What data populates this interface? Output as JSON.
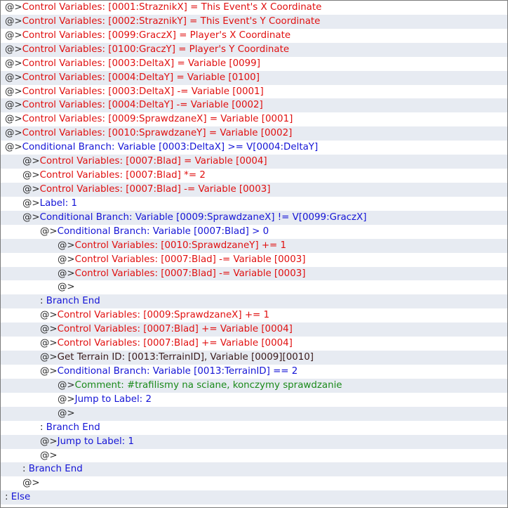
{
  "event_commands": [
    {
      "indent": 0,
      "prefix": "@>",
      "text": "Control Variables: [0001:StraznikX] = This Event's X Coordinate",
      "color": "red"
    },
    {
      "indent": 0,
      "prefix": "@>",
      "text": "Control Variables: [0002:StraznikY] = This Event's Y Coordinate",
      "color": "red"
    },
    {
      "indent": 0,
      "prefix": "@>",
      "text": "Control Variables: [0099:GraczX] = Player's X Coordinate",
      "color": "red"
    },
    {
      "indent": 0,
      "prefix": "@>",
      "text": "Control Variables: [0100:GraczY] = Player's Y Coordinate",
      "color": "red"
    },
    {
      "indent": 0,
      "prefix": "@>",
      "text": "Control Variables: [0003:DeltaX] = Variable [0099]",
      "color": "red"
    },
    {
      "indent": 0,
      "prefix": "@>",
      "text": "Control Variables: [0004:DeltaY] = Variable [0100]",
      "color": "red"
    },
    {
      "indent": 0,
      "prefix": "@>",
      "text": "Control Variables: [0003:DeltaX] -= Variable [0001]",
      "color": "red"
    },
    {
      "indent": 0,
      "prefix": "@>",
      "text": "Control Variables: [0004:DeltaY] -= Variable [0002]",
      "color": "red"
    },
    {
      "indent": 0,
      "prefix": "@>",
      "text": "Control Variables: [0009:SprawdzaneX] = Variable [0001]",
      "color": "red"
    },
    {
      "indent": 0,
      "prefix": "@>",
      "text": "Control Variables: [0010:SprawdzaneY] = Variable [0002]",
      "color": "red"
    },
    {
      "indent": 0,
      "prefix": "@>",
      "text": "Conditional Branch: Variable [0003:DeltaX] >= V[0004:DeltaY]",
      "color": "blue"
    },
    {
      "indent": 1,
      "prefix": "@>",
      "text": "Control Variables: [0007:Blad] = Variable [0004]",
      "color": "red"
    },
    {
      "indent": 1,
      "prefix": "@>",
      "text": "Control Variables: [0007:Blad] *= 2",
      "color": "red"
    },
    {
      "indent": 1,
      "prefix": "@>",
      "text": "Control Variables: [0007:Blad] -= Variable [0003]",
      "color": "red"
    },
    {
      "indent": 1,
      "prefix": "@>",
      "text": "Label: 1",
      "color": "blue"
    },
    {
      "indent": 1,
      "prefix": "@>",
      "text": "Conditional Branch: Variable [0009:SprawdzaneX] != V[0099:GraczX]",
      "color": "blue"
    },
    {
      "indent": 2,
      "prefix": "@>",
      "text": "Conditional Branch: Variable [0007:Blad] > 0",
      "color": "blue"
    },
    {
      "indent": 3,
      "prefix": "@>",
      "text": "Control Variables: [0010:SprawdzaneY] += 1",
      "color": "red"
    },
    {
      "indent": 3,
      "prefix": "@>",
      "text": "Control Variables: [0007:Blad] -= Variable [0003]",
      "color": "red"
    },
    {
      "indent": 3,
      "prefix": "@>",
      "text": "Control Variables: [0007:Blad] -= Variable [0003]",
      "color": "red"
    },
    {
      "indent": 3,
      "prefix": "@>",
      "text": "",
      "color": "dark"
    },
    {
      "indent": 2,
      "prefix": " : ",
      "text": "Branch End",
      "color": "blue"
    },
    {
      "indent": 2,
      "prefix": "@>",
      "text": "Control Variables: [0009:SprawdzaneX] += 1",
      "color": "red"
    },
    {
      "indent": 2,
      "prefix": "@>",
      "text": "Control Variables: [0007:Blad] += Variable [0004]",
      "color": "red"
    },
    {
      "indent": 2,
      "prefix": "@>",
      "text": "Control Variables: [0007:Blad] += Variable [0004]",
      "color": "red"
    },
    {
      "indent": 2,
      "prefix": "@>",
      "text": "Get Terrain ID: [0013:TerrainID], Variable [0009][0010]",
      "color": "dark"
    },
    {
      "indent": 2,
      "prefix": "@>",
      "text": "Conditional Branch: Variable [0013:TerrainID] == 2",
      "color": "blue"
    },
    {
      "indent": 3,
      "prefix": "@>",
      "text": "Comment: #trafilismy na sciane, konczymy sprawdzanie",
      "color": "green"
    },
    {
      "indent": 3,
      "prefix": "@>",
      "text": "Jump to Label: 2",
      "color": "blue"
    },
    {
      "indent": 3,
      "prefix": "@>",
      "text": "",
      "color": "dark"
    },
    {
      "indent": 2,
      "prefix": " : ",
      "text": "Branch End",
      "color": "blue"
    },
    {
      "indent": 2,
      "prefix": "@>",
      "text": "Jump to Label: 1",
      "color": "blue"
    },
    {
      "indent": 2,
      "prefix": "@>",
      "text": "",
      "color": "dark"
    },
    {
      "indent": 1,
      "prefix": " : ",
      "text": "Branch End",
      "color": "blue"
    },
    {
      "indent": 1,
      "prefix": "@>",
      "text": "",
      "color": "dark"
    },
    {
      "indent": 0,
      "prefix": " : ",
      "text": "Else",
      "color": "blue"
    }
  ],
  "colors": {
    "red": "#e01010",
    "blue": "#1414d6",
    "green": "#1a8a1a",
    "dark": "#3a1a1a",
    "prefix": "#2b2b2b",
    "alt_row": "#e7ebf2",
    "border": "#7a7a7a"
  }
}
